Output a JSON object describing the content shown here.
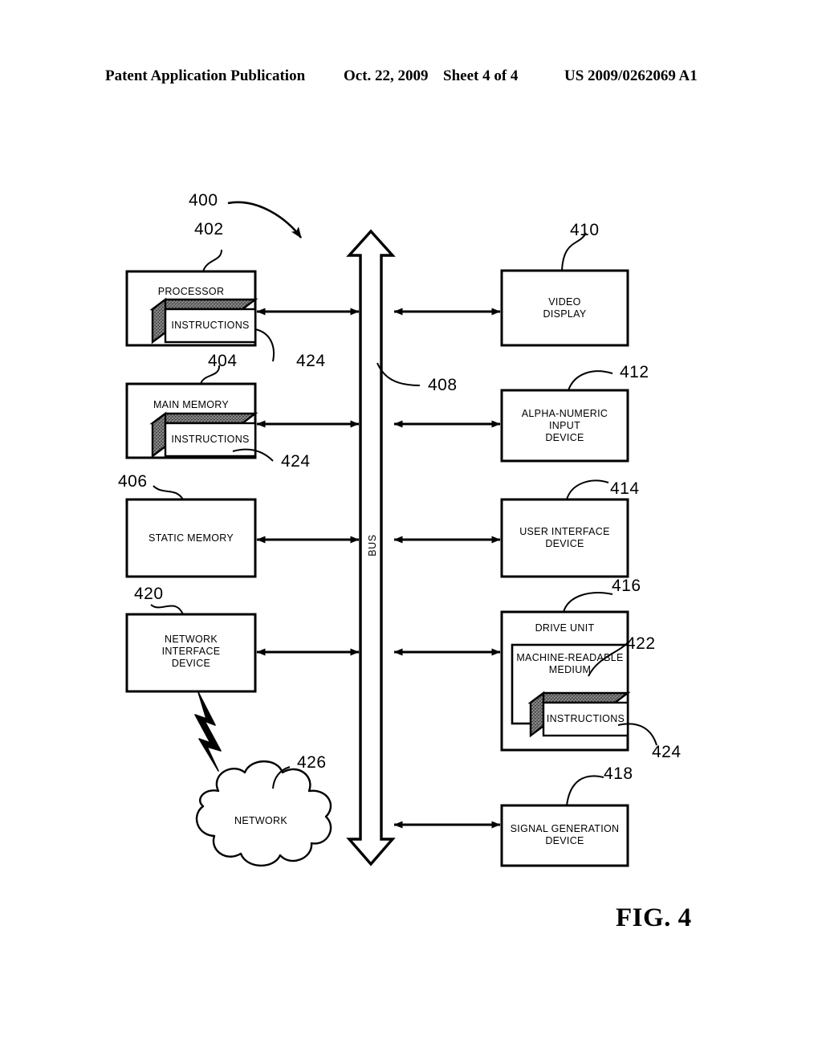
{
  "header": {
    "publication": "Patent Application Publication",
    "date": "Oct. 22, 2009",
    "sheet": "Sheet 4 of 4",
    "patent_number": "US 2009/0262069 A1"
  },
  "figure": {
    "caption": "FIG. 4",
    "system_ref": "400",
    "bus_label": "BUS",
    "bus_ref": "408",
    "blocks": [
      {
        "id": "processor",
        "label": "PROCESSOR",
        "ref": "402"
      },
      {
        "id": "main-memory",
        "label": "MAIN MEMORY",
        "ref": "404"
      },
      {
        "id": "static-memory",
        "label": "STATIC MEMORY",
        "ref": "406"
      },
      {
        "id": "network-interface",
        "label": "NETWORK\nINTERFACE\nDEVICE",
        "ref": "420"
      },
      {
        "id": "video-display",
        "label": "VIDEO\nDISPLAY",
        "ref": "410"
      },
      {
        "id": "alpha-numeric-input",
        "label": "ALPHA-NUMERIC\nINPUT\nDEVICE",
        "ref": "412"
      },
      {
        "id": "user-interface",
        "label": "USER INTERFACE\nDEVICE",
        "ref": "414"
      },
      {
        "id": "drive-unit",
        "label": "DRIVE UNIT",
        "ref": "416"
      },
      {
        "id": "machine-readable",
        "label": "MACHINE-READABLE\nMEDIUM",
        "ref": "422"
      },
      {
        "id": "signal-generation",
        "label": "SIGNAL GENERATION\nDEVICE",
        "ref": "418"
      },
      {
        "id": "network-cloud",
        "label": "NETWORK",
        "ref": "426"
      }
    ],
    "instructions": {
      "label": "INSTRUCTIONS",
      "ref": "424",
      "occurrences": 3
    },
    "ref_numbers": {
      "system": "400",
      "processor": "402",
      "main_memory": "404",
      "static_memory": "406",
      "bus": "408",
      "video_display": "410",
      "alpha_numeric_input": "412",
      "user_interface": "414",
      "drive_unit": "416",
      "signal_generation": "418",
      "network_interface": "420",
      "machine_readable_medium": "422",
      "instructions_processor": "424",
      "instructions_main_memory": "424",
      "instructions_drive_unit": "424",
      "network": "426"
    },
    "colors": {
      "ink": "#000000",
      "paper": "#ffffff",
      "instruction_block_fill": "#6e6e6e"
    }
  }
}
